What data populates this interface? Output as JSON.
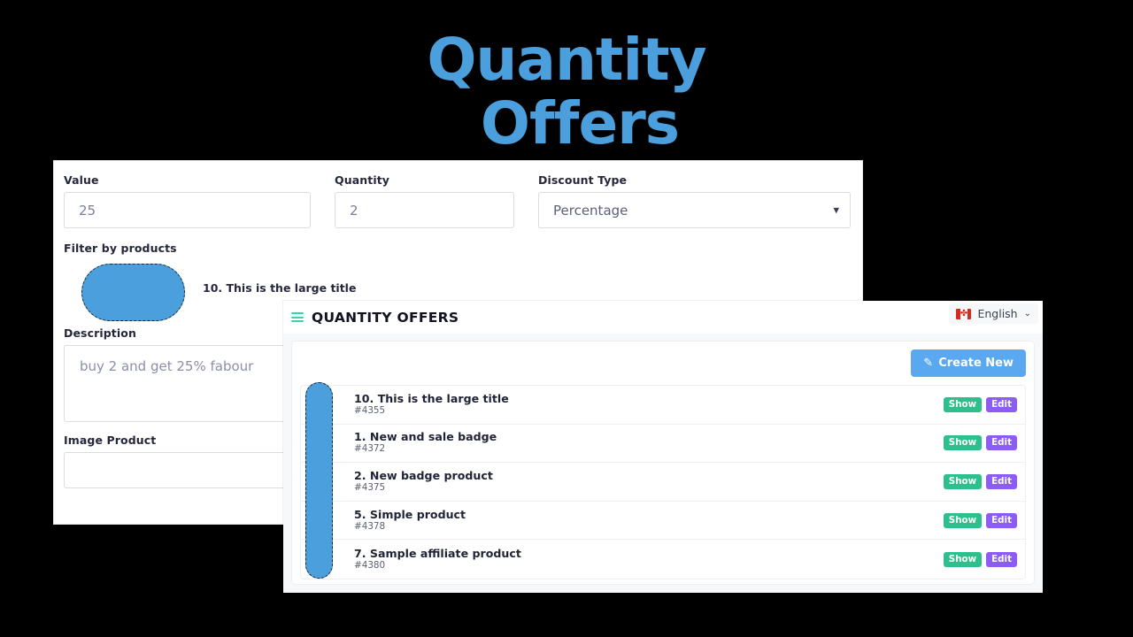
{
  "hero": {
    "line1": "Quantity",
    "line2": "Offers",
    "color": "#4a9fdc"
  },
  "form": {
    "value": {
      "label": "Value",
      "value": "25"
    },
    "quantity": {
      "label": "Quantity",
      "value": "2"
    },
    "discount_type": {
      "label": "Discount Type",
      "selected": "Percentage",
      "chevron": "chevron-down-icon"
    },
    "filter_products": {
      "label": "Filter by products",
      "selected_product": "10. This is the large title"
    },
    "description": {
      "label": "Description",
      "value": "buy 2 and get 25% fabour"
    },
    "image_product": {
      "label": "Image Product",
      "value": ""
    }
  },
  "app": {
    "menu_icon": "hamburger-menu-icon",
    "title": "QUANTITY OFFERS",
    "language": {
      "flag": "canada-flag-icon",
      "leaf": "✤",
      "label": "English",
      "chevron": "⌄"
    },
    "create_button": {
      "label": "Create New",
      "icon": "✎"
    },
    "row_actions": {
      "show": "Show",
      "edit": "Edit"
    },
    "offers": [
      {
        "title": "10. This is the large title",
        "id": "#4355"
      },
      {
        "title": "1. New and sale badge",
        "id": "#4372"
      },
      {
        "title": "2. New badge product",
        "id": "#4375"
      },
      {
        "title": "5. Simple product",
        "id": "#4378"
      },
      {
        "title": "7. Sample affiliate product",
        "id": "#4380"
      }
    ]
  },
  "annotations": {
    "highlight_color": "#4a9fdc",
    "shapes": [
      "product-image-highlight",
      "offer-list-highlight"
    ]
  }
}
